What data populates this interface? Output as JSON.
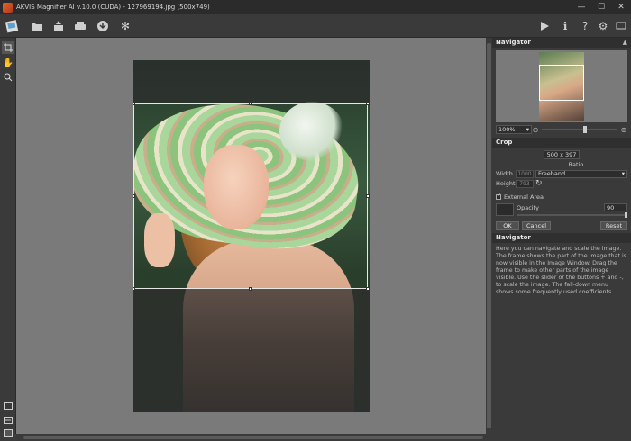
{
  "window": {
    "title": "AKVIS Magnifier AI v.10.0 (CUDA) - 127969194.jpg (500x749)",
    "controls": {
      "minimize": "—",
      "maximize": "☐",
      "close": "✕"
    }
  },
  "toolbar": {
    "left_icons": [
      "logo-icon",
      "open-icon",
      "save-icon",
      "print-icon",
      "share-icon",
      "settings-gears-icon"
    ],
    "right_icons": [
      "run-icon",
      "info-icon",
      "help-icon",
      "preferences-icon",
      "hints-icon"
    ]
  },
  "left_tools": [
    "crop-tool-icon",
    "hand-tool-icon",
    "zoom-tool-icon"
  ],
  "navigator": {
    "header": "Navigator",
    "zoom_value": "100%"
  },
  "crop": {
    "header": "Crop",
    "size": "500 x 397",
    "ratio_label": "Ratio",
    "width_label": "Width",
    "width_value": "1000",
    "height_label": "Height",
    "height_value": "793",
    "ratio_value": "Freehand",
    "external_area_label": "External Area",
    "opacity_label": "Opacity",
    "opacity_value": "90",
    "ok_label": "OK",
    "cancel_label": "Cancel",
    "reset_label": "Reset"
  },
  "help": {
    "header": "Navigator",
    "text": "Here you can navigate and scale the image. The frame shows the part of the image that is now visible in the Image Window. Drag the frame to make other parts of the image visible. Use the slider or the buttons + and -, to scale the image. The fall-down menu shows some frequently used coefficients."
  }
}
